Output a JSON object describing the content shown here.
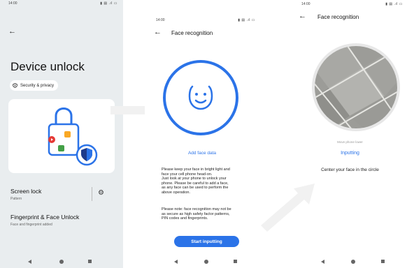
{
  "screen1": {
    "status_time": "14:00",
    "status_icons": "▮ ▤ .ıl ▭",
    "title": "Device unlock",
    "chip_label": "Security & privacy",
    "screen_lock": {
      "title": "Screen lock",
      "subtitle": "Pattern"
    },
    "fingerprint": {
      "title": "Fingerprint & Face Unlock",
      "subtitle": "Face and fingerprint added"
    }
  },
  "screen2": {
    "status_time": "14:00",
    "status_icons": "▮ ▤ .ıl ▭",
    "title": "Face recognition",
    "add_face": "Add face data",
    "instructions": [
      "Please keep your face in bright light and",
      "face your cell phone head-on.",
      "Just look at your phone to unlock your",
      "phone. Please be careful to add a face,",
      "as any face can be used to perform the",
      "above operation."
    ],
    "note": [
      "Please note: face recognition may not be",
      "as secure as high safety factor patterns,",
      "PIN codes and fingerprints."
    ],
    "start_button": "Start inputting"
  },
  "screen3": {
    "status_time": "14:00",
    "status_icons": "▮ ▤ .ıl ▭",
    "title": "Face recognition",
    "hint": "Move phone lower",
    "status": "Inputting",
    "instruction": "Center your face in the circle"
  },
  "colors": {
    "accent": "#2b73e8",
    "screen1_bg": "#e9edef"
  },
  "icons": [
    "back-arrow-icon",
    "shield-icon",
    "gear-icon",
    "smiley-face-icon",
    "nav-back-icon",
    "nav-home-icon",
    "nav-recent-icon"
  ]
}
